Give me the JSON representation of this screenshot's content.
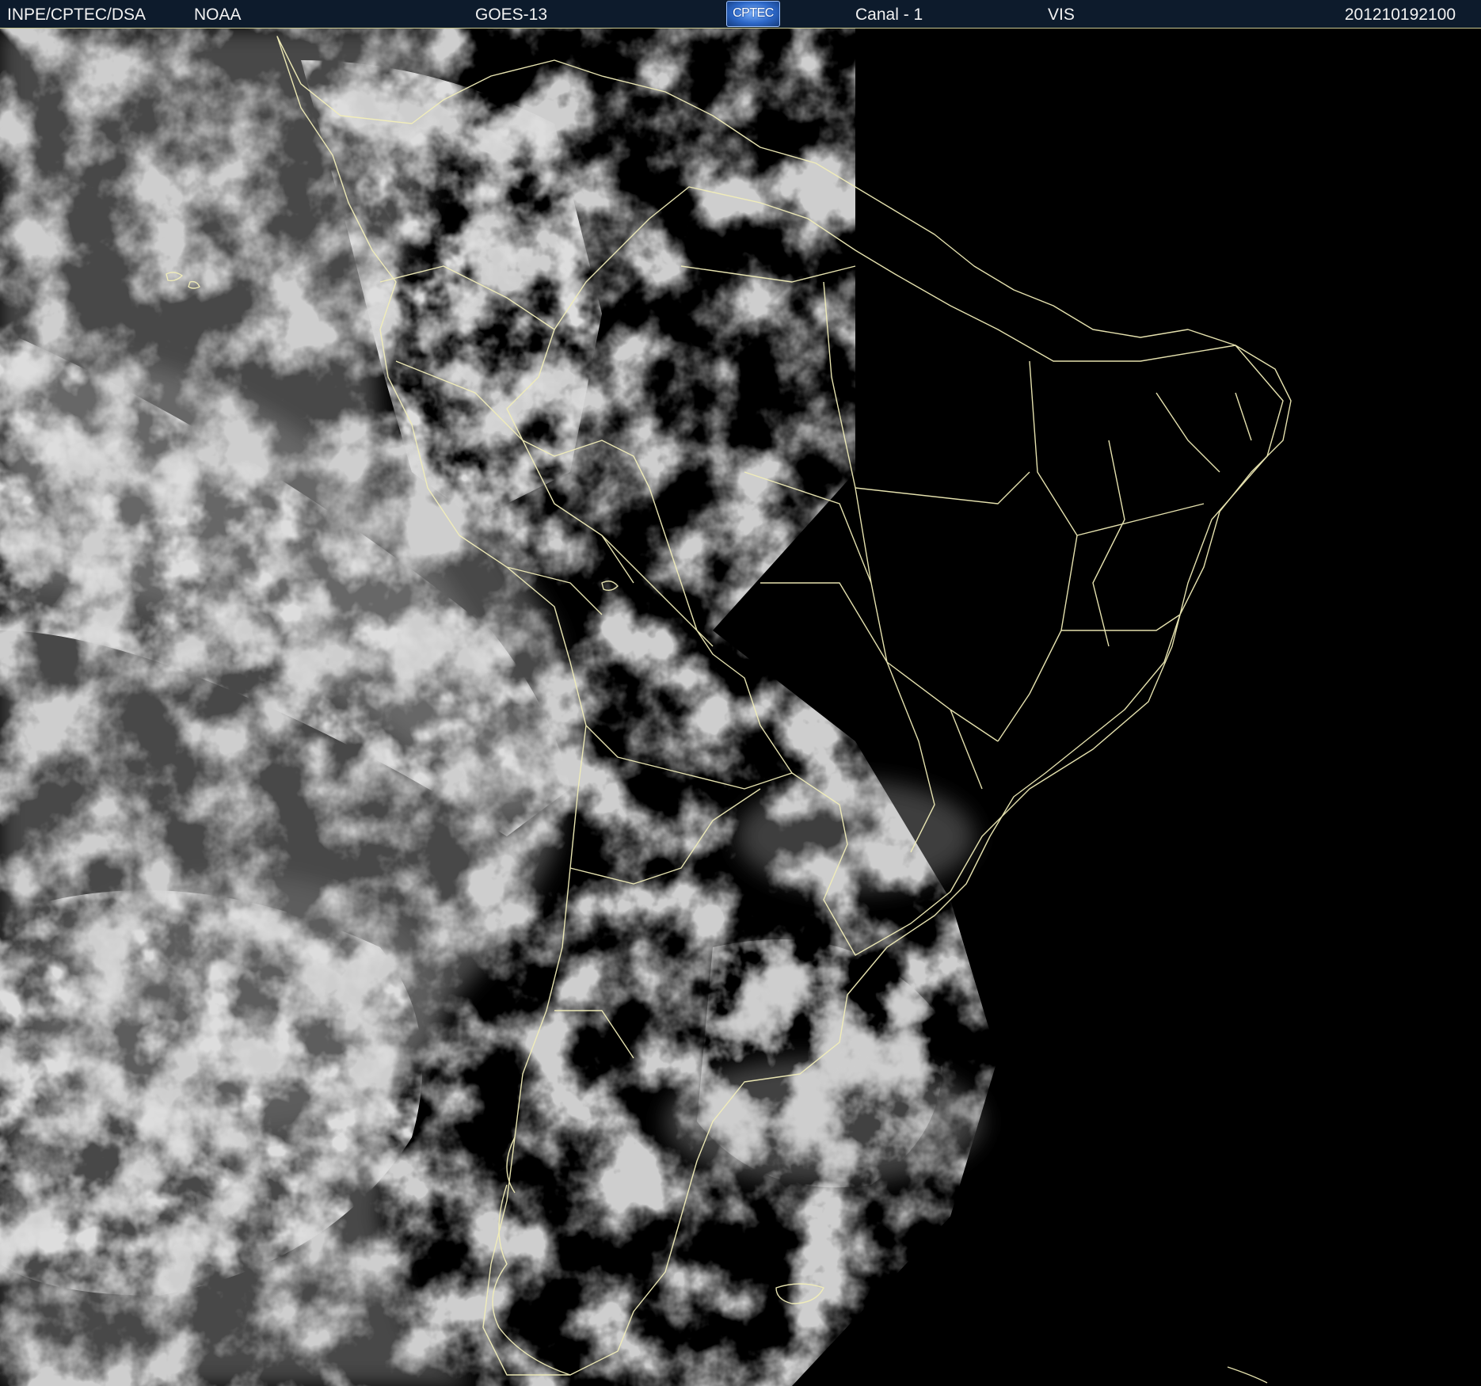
{
  "header": {
    "organization": "INPE/CPTEC/DSA",
    "agency": "NOAA",
    "satellite": "GOES-13",
    "logo_text": "CPTEC",
    "channel": "Canal - 1",
    "band": "VIS",
    "timestamp": "201210192100"
  },
  "colors": {
    "header_background": "#0d1b2c",
    "header_text": "#f2f2f2",
    "border_lines": "#f2eeb8",
    "space_background": "#000000",
    "cloud_gray": "#8a8a8a"
  },
  "imagery": {
    "type": "visible satellite image",
    "region": "South America"
  }
}
